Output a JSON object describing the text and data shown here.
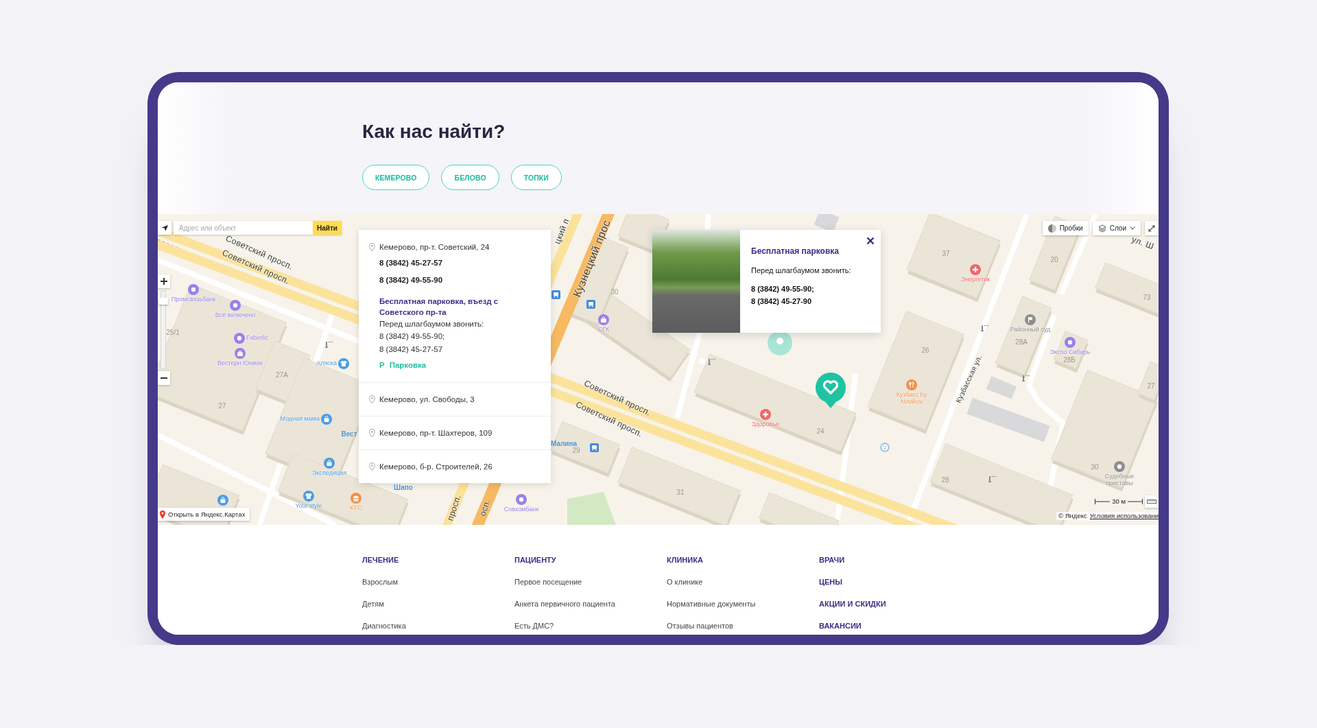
{
  "heading": "Как нас найти?",
  "city_tabs": [
    "КЕМЕРОВО",
    "БЕЛОВО",
    "ТОПКИ"
  ],
  "map": {
    "search": {
      "placeholder": "Адрес или объект",
      "button": "Найти"
    },
    "zoom": {
      "level": 0.9
    },
    "open_link": "Открыть в Яндекс.Картах",
    "traffic_button": "Пробки",
    "layers_button": "Слои",
    "scale": "30 м",
    "copyright": "© Яндекс",
    "terms_link": "Условия использовани",
    "labels": [
      {
        "kind": "street",
        "text": "Советский просп."
      },
      {
        "kind": "street",
        "text": "Советский просп."
      },
      {
        "kind": "street",
        "text": "цкий п"
      },
      {
        "kind": "street",
        "text": "Кузнецкий прос"
      },
      {
        "kind": "street",
        "text": "Советский просп."
      },
      {
        "kind": "street",
        "text": "Советский просп."
      },
      {
        "kind": "street",
        "text": "просп."
      },
      {
        "kind": "street",
        "text": "осп."
      },
      {
        "kind": "street",
        "text": "Кузбасская ул."
      },
      {
        "kind": "street",
        "text": "ул. Ш"
      },
      {
        "kind": "house",
        "text": "25/1"
      },
      {
        "kind": "house",
        "text": "27А"
      },
      {
        "kind": "house",
        "text": "27"
      },
      {
        "kind": "house",
        "text": "30"
      },
      {
        "kind": "house",
        "text": "29"
      },
      {
        "kind": "house",
        "text": "31"
      },
      {
        "kind": "house",
        "text": "24"
      },
      {
        "kind": "house",
        "text": "37"
      },
      {
        "kind": "house",
        "text": "20"
      },
      {
        "kind": "house",
        "text": "73"
      },
      {
        "kind": "house",
        "text": "28А"
      },
      {
        "kind": "house",
        "text": "28Б"
      },
      {
        "kind": "house",
        "text": "26"
      },
      {
        "kind": "house",
        "text": "27"
      },
      {
        "kind": "house",
        "text": "30"
      },
      {
        "kind": "house",
        "text": "28"
      },
      {
        "kind": "poi",
        "text": "Промсвязьбанк",
        "color": "#9b80e8"
      },
      {
        "kind": "poi",
        "text": "Всё включено",
        "color": "#9b80e8"
      },
      {
        "kind": "poi",
        "text": "Faberlic",
        "color": "#9b80e8"
      },
      {
        "kind": "poi",
        "text": "Вестерн Юнион",
        "color": "#9b80e8"
      },
      {
        "kind": "poi",
        "text": "Аляска",
        "color": "#4a9de6"
      },
      {
        "kind": "poi",
        "text": "Модная мама",
        "color": "#4a9de6"
      },
      {
        "kind": "poi",
        "text": "Экспедиция",
        "color": "#4a9de6"
      },
      {
        "kind": "poi",
        "color": "#4a9de6"
      },
      {
        "kind": "poi",
        "text": "Your style",
        "color": "#4a9de6"
      },
      {
        "kind": "poi",
        "text": "KFC",
        "color": "#f2914a"
      },
      {
        "kind": "poi",
        "text": "Совкомбанк",
        "color": "#9b80e8"
      },
      {
        "kind": "poi",
        "text": "СГК",
        "color": "#9b80e8"
      },
      {
        "kind": "poi",
        "text": "Малина",
        "color": "#4a9de6"
      },
      {
        "kind": "poi",
        "text": "Здоровье",
        "color": "#f0666e"
      },
      {
        "kind": "poi",
        "text": "Энергетик",
        "color": "#f0666e"
      },
      {
        "kind": "poi",
        "text": "Районный суд",
        "color": "#8e8e8e"
      },
      {
        "kind": "poi",
        "text": "Экспо Сибирь",
        "color": "#9b80e8"
      },
      {
        "kind": "poi",
        "text": "Кузбасс by Novikov",
        "color": "#f2914a"
      },
      {
        "kind": "poi",
        "text": "Судебные приставы",
        "color": "#8e8e8e"
      },
      {
        "kind": "poi",
        "text": "Вест",
        "color": "#4a9de6"
      },
      {
        "kind": "poi",
        "text": "Шапо",
        "color": "#4a9de6"
      }
    ]
  },
  "address_panel": {
    "offices": [
      {
        "address": "Кемерово, пр-т. Советский, 24",
        "phones": [
          "8 (3842) 45-27-57",
          "8 (3842) 49-55-90"
        ],
        "parking": {
          "title": "Бесплатная парковка, въезд с Советского пр-та",
          "note": "Перед шлагбаумом звонить:",
          "phones": [
            "8 (3842) 49-55-90;",
            "8 (3842) 45-27-57"
          ],
          "sign": "Р",
          "link": "Парковка"
        }
      },
      {
        "address": "Кемерово, ул. Свободы, 3"
      },
      {
        "address": "Кемерово, пр-т. Шахтеров, 109"
      },
      {
        "address": "Кемерово, б-р. Строителей, 26"
      }
    ]
  },
  "popup": {
    "title": "Бесплатная парковка",
    "note": "Перед шлагбаумом звонить:",
    "phones": [
      "8 (3842) 49-55-90;",
      "8 (3842) 45-27-90"
    ]
  },
  "footer": {
    "columns": [
      {
        "heading": "ЛЕЧЕНИЕ",
        "links": [
          "Взрослым",
          "Детям",
          "Диагностика"
        ]
      },
      {
        "heading": "ПАЦИЕНТУ",
        "links": [
          "Первое посещение",
          "Анкета первичного пациента",
          "Есть ДМС?"
        ]
      },
      {
        "heading": "КЛИНИКА",
        "links": [
          "О клинике",
          "Нормативные документы",
          "Отзывы пациентов"
        ]
      }
    ],
    "main_links": [
      "ВРАЧИ",
      "ЦЕНЫ",
      "АКЦИИ И СКИДКИ",
      "ВАКАНСИИ"
    ]
  }
}
